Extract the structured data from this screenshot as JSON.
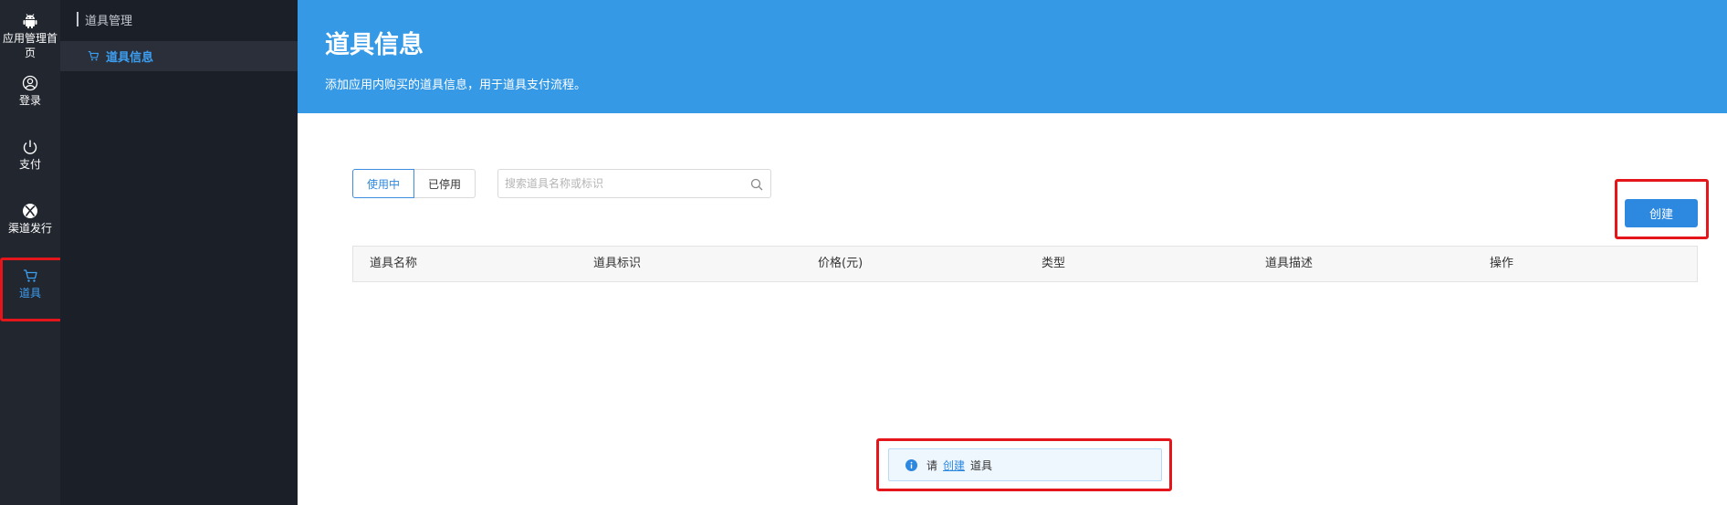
{
  "rail": {
    "items": [
      {
        "label": "应用管理首页",
        "icon": "android-icon"
      },
      {
        "label": "登录",
        "icon": "user-icon"
      },
      {
        "label": "支付",
        "icon": "power-icon"
      },
      {
        "label": "渠道发行",
        "icon": "xbox-icon"
      },
      {
        "label": "道具",
        "icon": "cart-icon"
      }
    ]
  },
  "sidebar": {
    "header": "道具管理",
    "item": "道具信息"
  },
  "banner": {
    "title": "道具信息",
    "subtitle": "添加应用内购买的道具信息，用于道具支付流程。"
  },
  "filters": {
    "active_label": "使用中",
    "inactive_label": "已停用",
    "search_placeholder": "搜索道具名称或标识"
  },
  "actions": {
    "create_label": "创建"
  },
  "table": {
    "columns": [
      "道具名称",
      "道具标识",
      "价格(元)",
      "类型",
      "道具描述",
      "操作"
    ]
  },
  "notice": {
    "prefix": "请",
    "link": "创建",
    "suffix": "道具"
  },
  "colors": {
    "accent": "#2d88e0",
    "banner": "#3599e6",
    "highlight": "#e4161b",
    "rail_bg": "#22262f",
    "sidebar_bg": "#1b1f27"
  }
}
